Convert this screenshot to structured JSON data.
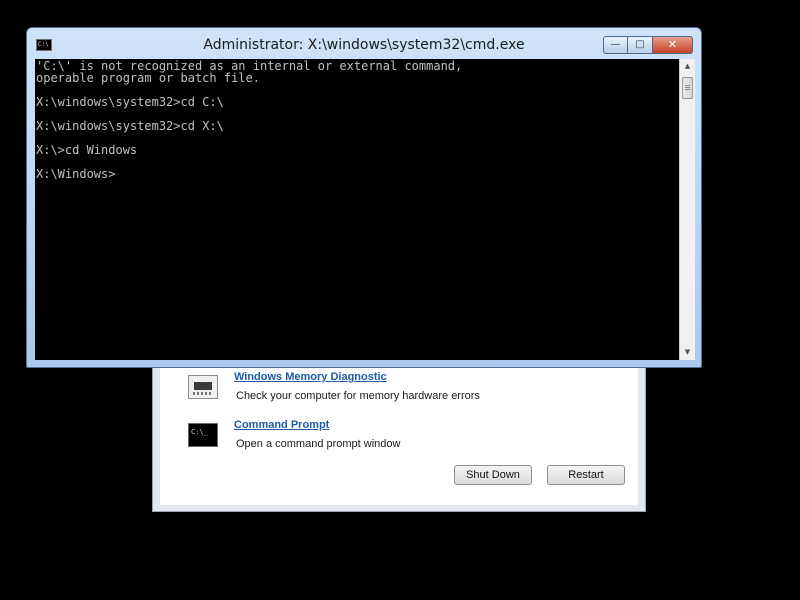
{
  "cmd_window": {
    "title": "Administrator: X:\\windows\\system32\\cmd.exe",
    "icon_text": "C:\\",
    "caption_buttons": {
      "minimize": "—",
      "maximize": "□",
      "close": "✕"
    },
    "console_lines": [
      "'C:\\' is not recognized as an internal or external command,",
      "operable program or batch file.",
      "X:\\windows\\system32>cd C:\\",
      "X:\\windows\\system32>cd X:\\",
      "X:\\>cd Windows",
      "X:\\Windows>"
    ],
    "scrollbar": {
      "up_arrow": "▲",
      "down_arrow": "▼"
    }
  },
  "recovery_panel": {
    "tools": [
      {
        "name": "Windows Memory Diagnostic",
        "description": "Check your computer for memory hardware errors",
        "icon": "memory-chip-icon"
      },
      {
        "name": "Command Prompt",
        "description": "Open a command prompt window",
        "icon": "command-prompt-icon",
        "icon_text": "C:\\_"
      }
    ],
    "buttons": {
      "shutdown": "Shut Down",
      "restart": "Restart"
    }
  },
  "colors": {
    "link": "#1e5aa8",
    "console_text": "#c0c0c0",
    "console_bg": "#000000",
    "close_button": "#c4412a"
  }
}
